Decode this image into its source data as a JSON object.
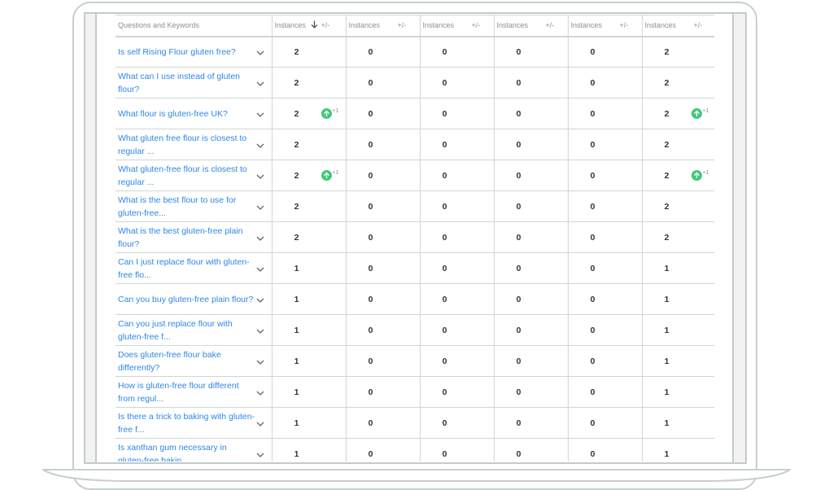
{
  "table": {
    "columns": [
      {
        "label": "Questions and Keywords"
      },
      {
        "label": "Instances",
        "delta_label": "+/-",
        "sorted": true,
        "sort_icon": "arrow-down-icon"
      },
      {
        "label": "Instances",
        "delta_label": "+/-"
      },
      {
        "label": "Instances",
        "delta_label": "+/-"
      },
      {
        "label": "Instances",
        "delta_label": "+/-"
      },
      {
        "label": "Instances",
        "delta_label": "+/-"
      },
      {
        "label": "Instances",
        "delta_label": "+/-"
      }
    ],
    "rows": [
      {
        "question": "Is self Rising Flour gluten free?",
        "values": [
          "2",
          "0",
          "0",
          "0",
          "0",
          "2"
        ],
        "deltas": [
          "",
          "",
          "",
          "",
          "",
          ""
        ]
      },
      {
        "question": "What can I use instead of gluten flour?",
        "values": [
          "2",
          "0",
          "0",
          "0",
          "0",
          "2"
        ],
        "deltas": [
          "",
          "",
          "",
          "",
          "",
          ""
        ]
      },
      {
        "question": "What flour is gluten-free UK?",
        "values": [
          "2",
          "0",
          "0",
          "0",
          "0",
          "2"
        ],
        "deltas": [
          "+1",
          "",
          "",
          "",
          "",
          "+1"
        ]
      },
      {
        "question": "What gluten free flour is closest to regular ...",
        "values": [
          "2",
          "0",
          "0",
          "0",
          "0",
          "2"
        ],
        "deltas": [
          "",
          "",
          "",
          "",
          "",
          ""
        ]
      },
      {
        "question": "What gluten-free flour is closest to regular ...",
        "values": [
          "2",
          "0",
          "0",
          "0",
          "0",
          "2"
        ],
        "deltas": [
          "+1",
          "",
          "",
          "",
          "",
          "+1"
        ]
      },
      {
        "question": "What is the best flour to use for gluten-free...",
        "values": [
          "2",
          "0",
          "0",
          "0",
          "0",
          "2"
        ],
        "deltas": [
          "",
          "",
          "",
          "",
          "",
          ""
        ]
      },
      {
        "question": "What is the best gluten-free plain flour?",
        "values": [
          "2",
          "0",
          "0",
          "0",
          "0",
          "2"
        ],
        "deltas": [
          "",
          "",
          "",
          "",
          "",
          ""
        ]
      },
      {
        "question": "Can I just replace flour with gluten-free flo...",
        "values": [
          "1",
          "0",
          "0",
          "0",
          "0",
          "1"
        ],
        "deltas": [
          "",
          "",
          "",
          "",
          "",
          ""
        ]
      },
      {
        "question": "Can you buy gluten-free plain flour?",
        "values": [
          "1",
          "0",
          "0",
          "0",
          "0",
          "1"
        ],
        "deltas": [
          "",
          "",
          "",
          "",
          "",
          ""
        ]
      },
      {
        "question": "Can you just replace flour with gluten-free f...",
        "values": [
          "1",
          "0",
          "0",
          "0",
          "0",
          "1"
        ],
        "deltas": [
          "",
          "",
          "",
          "",
          "",
          ""
        ]
      },
      {
        "question": "Does gluten-free flour bake differently?",
        "values": [
          "1",
          "0",
          "0",
          "0",
          "0",
          "1"
        ],
        "deltas": [
          "",
          "",
          "",
          "",
          "",
          ""
        ]
      },
      {
        "question": "How is gluten-free flour different from regul...",
        "values": [
          "1",
          "0",
          "0",
          "0",
          "0",
          "1"
        ],
        "deltas": [
          "",
          "",
          "",
          "",
          "",
          ""
        ]
      },
      {
        "question": "Is there a trick to baking with gluten-free f...",
        "values": [
          "1",
          "0",
          "0",
          "0",
          "0",
          "1"
        ],
        "deltas": [
          "",
          "",
          "",
          "",
          "",
          ""
        ]
      },
      {
        "question": "Is xanthan gum necessary in gluten-free bakin...",
        "values": [
          "1",
          "0",
          "0",
          "0",
          "0",
          "1"
        ],
        "deltas": [
          "",
          "",
          "",
          "",
          "",
          ""
        ]
      }
    ]
  },
  "colors": {
    "link": "#2f86e6",
    "up_badge": "#3ec978",
    "header_text": "#8a8f91",
    "grid": "#cfd6d5"
  },
  "icons": {
    "row_expand": "chevron-down-icon",
    "delta_up": "arrow-up-circle-icon"
  }
}
